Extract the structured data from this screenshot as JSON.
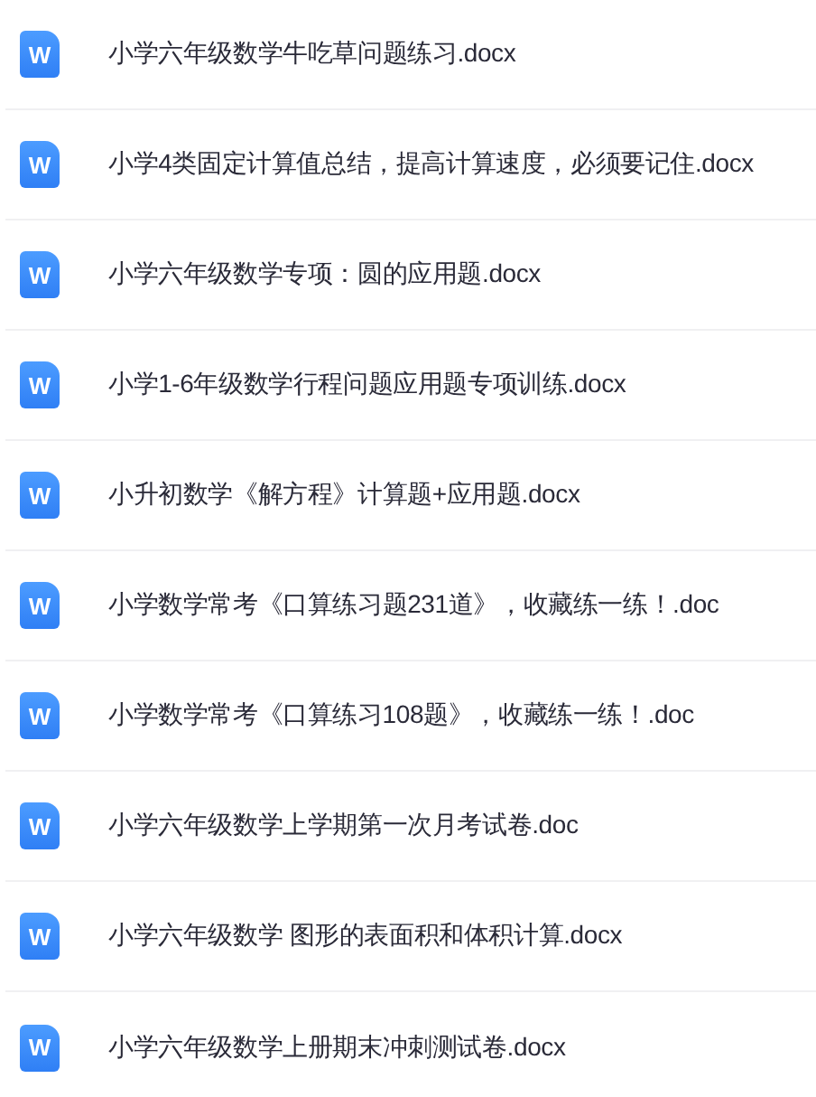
{
  "files": [
    {
      "icon_letter": "W",
      "name": "小学六年级数学牛吃草问题练习.docx"
    },
    {
      "icon_letter": "W",
      "name": "小学4类固定计算值总结，提高计算速度，必须要记住.docx"
    },
    {
      "icon_letter": "W",
      "name": "小学六年级数学专项：圆的应用题.docx"
    },
    {
      "icon_letter": "W",
      "name": "小学1-6年级数学行程问题应用题专项训练.docx"
    },
    {
      "icon_letter": "W",
      "name": "小升初数学《解方程》计算题+应用题.docx"
    },
    {
      "icon_letter": "W",
      "name": "小学数学常考《口算练习题231道》，收藏练一练！.doc"
    },
    {
      "icon_letter": "W",
      "name": "小学数学常考《口算练习108题》，收藏练一练！.doc"
    },
    {
      "icon_letter": "W",
      "name": "小学六年级数学上学期第一次月考试卷.doc"
    },
    {
      "icon_letter": "W",
      "name": "小学六年级数学 图形的表面积和体积计算.docx"
    },
    {
      "icon_letter": "W",
      "name": "小学六年级数学上册期末冲刺测试卷.docx"
    }
  ]
}
